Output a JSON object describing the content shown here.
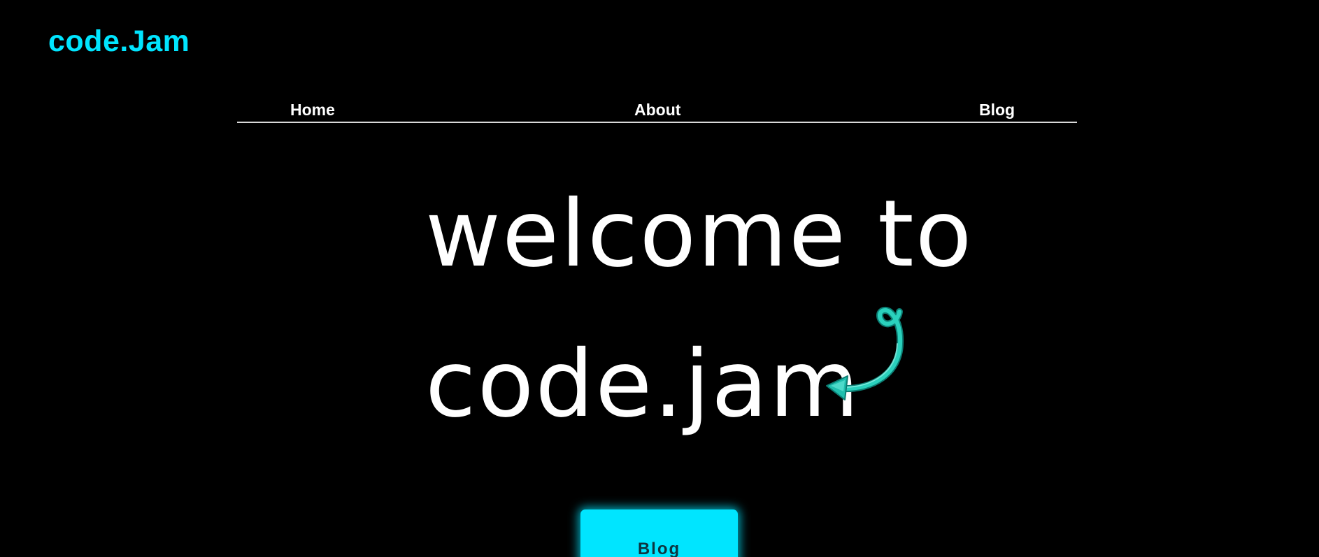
{
  "header": {
    "logo_text": "code.Jam"
  },
  "nav": {
    "items": [
      {
        "label": "Home"
      },
      {
        "label": "About"
      },
      {
        "label": "Blog"
      }
    ]
  },
  "hero": {
    "line1": "welcome to",
    "line2": "code.jam",
    "arrow_icon": "curly-arrow-left-icon",
    "cta_label": "Blog"
  },
  "colors": {
    "background": "#000000",
    "accent": "#00e5ff",
    "text": "#ffffff",
    "nav_underline": "#d9d9d9",
    "arrow": "#1fbfae"
  }
}
